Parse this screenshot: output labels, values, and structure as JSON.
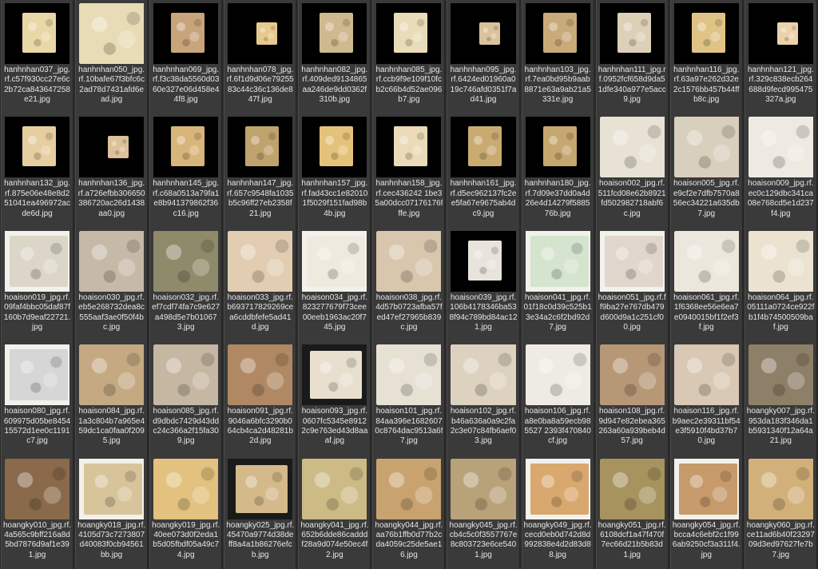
{
  "files": [
    {
      "label": "hanhnhan037_jpg.rf.c57f930cc27e6c2b72ca843647258e21.jpg",
      "style": "small",
      "color": "#e9d7a6"
    },
    {
      "label": "hanhnhan050_jpg.rf.10bafe67f3bfc6c2ad78d7431afd6ead.jpg",
      "style": "full",
      "color": "#e8dcb6"
    },
    {
      "label": "hanhnhan069_jpg.rf.f3c38da5560d0360e327e06d458e44f8.jpg",
      "style": "small",
      "color": "#c8a47b"
    },
    {
      "label": "hanhnhan078_jpg.rf.6f1d9d06e7925583c44c36c136de847f.jpg",
      "style": "tiny",
      "color": "#e6c98c"
    },
    {
      "label": "hanhnhan082_jpg.rf.409ded9134865aa246de9dd0362f310b.jpg",
      "style": "small",
      "color": "#cfb98f"
    },
    {
      "label": "hanhnhan085_jpg.rf.ccb9f9e109f10fcb2c66b4d52ae096b7.jpg",
      "style": "small",
      "color": "#e9dcb8"
    },
    {
      "label": "hanhnhan095_jpg.rf.6424ed01960a019c746afd0351f7ad41.jpg",
      "style": "tiny",
      "color": "#d9c29c"
    },
    {
      "label": "hanhnhan103_jpg.rf.7ea0bd95b9aab8871e63a9ab21a5331e.jpg",
      "style": "small",
      "color": "#c9ab7a"
    },
    {
      "label": "hanhnhan111_jpg.rf.0952fcf658d9da51dfe340a977e5acc9.jpg",
      "style": "small",
      "color": "#ddd0b8"
    },
    {
      "label": "hanhnhan116_jpg.rf.63a97e262d32e2c1576bb457b44ffb8c.jpg",
      "style": "small",
      "color": "#e0c487"
    },
    {
      "label": "hanhnhan121_jpg.rf.329c838ecb264688d9fecd995475327a.jpg",
      "style": "tiny",
      "color": "#ecd2aa"
    },
    {
      "label": "hanhnhan132_jpg.rf.875e06e48e8d251041ea496972acde6d.jpg",
      "style": "small",
      "color": "#e6ceA0"
    },
    {
      "label": "hanhnhan136_jpg.rf.a726efbb306650386720ac26d1438aa0.jpg",
      "style": "tiny",
      "color": "#dcc19a"
    },
    {
      "label": "hanhnhan145_jpg.rf.c68a0513a79fa1e8b941379862f36c16.jpg",
      "style": "small",
      "color": "#d8b57a"
    },
    {
      "label": "hanhnhan147_jpg.rf.657c9548fa1035b5c96ff27eb2358f21.jpg",
      "style": "small",
      "color": "#bfa36c"
    },
    {
      "label": "hanhnhan157_jpg.rf.fad43cc1e820101f5029f151fad98b4b.jpg",
      "style": "small",
      "color": "#e5c27a"
    },
    {
      "label": "hanhnhan158_jpg.rf.cec436242 1be35a00dcc07176176fffe.jpg",
      "style": "small",
      "color": "#eadab8"
    },
    {
      "label": "hanhnhan161_jpg.rf.d5ec962137fc2ee5fa67e9675ab4dc9.jpg",
      "style": "small",
      "color": "#c9ab72"
    },
    {
      "label": "hanhnhan180_jpg.rf.7d09e37dd0a4d26e4d14279f588576b.jpg",
      "style": "small",
      "color": "#c6a76f"
    },
    {
      "label": "hoaison002_jpg.rf.511fcd08e62b8921fd502982718abf6c.jpg",
      "style": "full",
      "color": "#e8e2d4"
    },
    {
      "label": "hoaison005_jpg.rf.e9cf2e7dfb7570a856ec34221a635db7.jpg",
      "style": "full",
      "color": "#d9cfbd"
    },
    {
      "label": "hoaison009_jpg.rf.ec0c129dbc341ca08e768cd5e1d237f4.jpg",
      "style": "full",
      "color": "#eeeae2"
    },
    {
      "label": "hoaison019_jpg.rf.09faf4bbc05daf87f160b7d9eaf22721.jpg",
      "style": "white",
      "color": "#dcd6c8"
    },
    {
      "label": "hoaison030_jpg.rf.eb5e268732dea8c555aaf3ae0f50f4bc.jpg",
      "style": "full",
      "color": "#c6b9a8"
    },
    {
      "label": "hoaison032_jpg.rf.ef7cdf74fa7c9e627a498d5e7b010673.jpg",
      "style": "full",
      "color": "#8f8a6a"
    },
    {
      "label": "hoaison033_jpg.rf.b693717829269cea6cddbfefe5ad41d.jpg",
      "style": "full",
      "color": "#e2cdb2"
    },
    {
      "label": "hoaison034_jpg.rf.823277679f73cee00eeb1963ac20f745.jpg",
      "style": "white",
      "color": "#efeadf"
    },
    {
      "label": "hoaison038_jpg.rf.4d57b0723afba57fed47ef27965b839c.jpg",
      "style": "full",
      "color": "#d8c6ad"
    },
    {
      "label": "hoaison039_jpg.rf.106b4178346ba538f94c789bd84ac121.jpg",
      "style": "small",
      "color": "#e8e4dc"
    },
    {
      "label": "hoaison041_jpg.rf.01f18c0d39c525b13e34a2c6f2bd92d7.jpg",
      "style": "white",
      "color": "#d5e4cf"
    },
    {
      "label": "hoaison051_jpg.rf.ff9ba27e767db479d600d9a1c251cf00.jpg",
      "style": "white",
      "color": "#e1d6cc"
    },
    {
      "label": "hoaison061_jpg.rf.1f6368ee56e6ea7e0940015bf1f2ef3f.jpg",
      "style": "full",
      "color": "#ece7dc"
    },
    {
      "label": "hoaison064_jpg.rf.05111a0724ce922fb1f4b74500509baf.jpg",
      "style": "full",
      "color": "#ebe3d0"
    },
    {
      "label": "hoaison080_jpg.rf.609975d05be845415572d1ee0c1191c7.jpg",
      "style": "white",
      "color": "#d6d6d6"
    },
    {
      "label": "hoaison084_jpg.rf.1a3c804b7a965e459dc1ca0faa0f2095.jpg",
      "style": "full",
      "color": "#c4a982"
    },
    {
      "label": "hoaison085_jpg.rf.d9dbdc7429d43ddc24c366a2f15fa309.jpg",
      "style": "full",
      "color": "#c5b7a1"
    },
    {
      "label": "hoaison091_jpg.rf.9046a6bfc3290b064cb4ca2d48281b2d.jpg",
      "style": "full",
      "color": "#b08863"
    },
    {
      "label": "hoaison093_jpg.rf.0607fc5345e89122c9e763ed43d8aaaf.jpg",
      "style": "dark",
      "color": "#e8dfcf"
    },
    {
      "label": "hoaison101_jpg.rf.84aa396e16826070c8764dac9513a6f7.jpg",
      "style": "full",
      "color": "#e7e1d4"
    },
    {
      "label": "hoaison102_jpg.rf.b46a636a0a9c2fa2c3e07c84fb6aef03.jpg",
      "style": "full",
      "color": "#ddd1bf"
    },
    {
      "label": "hoaison106_jpg.rf.a8e0ba8a59ecb985527 2393f470840cf.jpg",
      "style": "full",
      "color": "#eeebe3"
    },
    {
      "label": "hoaison108_jpg.rf.9d947e82ebea365263a60a939beb4d57.jpg",
      "style": "full",
      "color": "#b69776"
    },
    {
      "label": "hoaison116_jpg.rf.b9aec2e39311bf54e3f5910f4bd37b70.jpg",
      "style": "full",
      "color": "#d8c8b4"
    },
    {
      "label": "hoangky007_jpg.rf.953da183f346da1b5931340f12a64a21.jpg",
      "style": "full",
      "color": "#8d7f68"
    },
    {
      "label": "hoangky010_jpg.rf.4a565c9bff216a8d5bd7876d9af1e391.jpg",
      "style": "full",
      "color": "#8a6a4b"
    },
    {
      "label": "hoangky018_jpg.rf.4105d73c7273807d40083f0cb94561bb.jpg",
      "style": "white",
      "color": "#d7c49a"
    },
    {
      "label": "hoangky019_jpg.rf.40ee073d0f2eda1b5d05fbdf05a49c74.jpg",
      "style": "full",
      "color": "#e2c27e"
    },
    {
      "label": "hoangky025_jpg.rf.45470a9774d38deff8a4a1b86276efcb.jpg",
      "style": "dark",
      "color": "#d4b98a"
    },
    {
      "label": "hoangky041_jpg.rf.652b6dde86caddd f28a9d074e50ec4f2.jpg",
      "style": "full",
      "color": "#cdbb86"
    },
    {
      "label": "hoangky044_jpg.rf.aa76b1ffb0d77b2cda4059c25de5ae16.jpg",
      "style": "full",
      "color": "#c9a36f"
    },
    {
      "label": "hoangky045_jpg.rf.cb4c5c0f3557767e8c803723e6ce5401.jpg",
      "style": "full",
      "color": "#b8a27a"
    },
    {
      "label": "hoangky049_jpg.rf.cecd0eb0d742d8d992838e4d2d83d88.jpg",
      "style": "white",
      "color": "#d8a86e"
    },
    {
      "label": "hoangky051_jpg.rf.6108dcf1a47f470f7ec66d21b5b83d1.jpg",
      "style": "full",
      "color": "#a7935d"
    },
    {
      "label": "hoangky054_jpg.rf.bcca4c6ebf2c1f996ab9250cf3a311f4.jpg",
      "style": "white",
      "color": "#c79a6b"
    },
    {
      "label": "hoangky060_jpg.rf.ce11ad6b40f2329709d3ed97627fe7b7.jpg",
      "style": "full",
      "color": "#d2b07a"
    }
  ]
}
